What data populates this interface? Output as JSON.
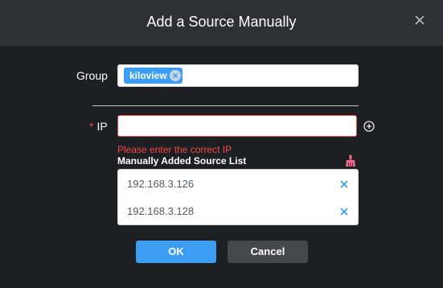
{
  "dialog": {
    "title": "Add a Source Manually"
  },
  "group": {
    "label": "Group",
    "tag": "kiloview"
  },
  "ip": {
    "required_mark": "*",
    "label": "IP",
    "value": "",
    "error": "Please enter the correct IP"
  },
  "list": {
    "title": "Manually Added Source List",
    "items": [
      {
        "ip": "192.168.3.126"
      },
      {
        "ip": "192.168.3.128"
      }
    ]
  },
  "buttons": {
    "ok": "OK",
    "cancel": "Cancel"
  },
  "icons": {
    "close": "close-icon",
    "tag_remove": "circle-x-icon",
    "add": "plus-circle-icon",
    "clear_list": "broom-icon",
    "item_remove": "x-icon"
  },
  "colors": {
    "accent": "#3d9df2",
    "error": "#ef4a4a",
    "header_bg": "#2f3036",
    "dialog_bg": "#1e1f23"
  }
}
